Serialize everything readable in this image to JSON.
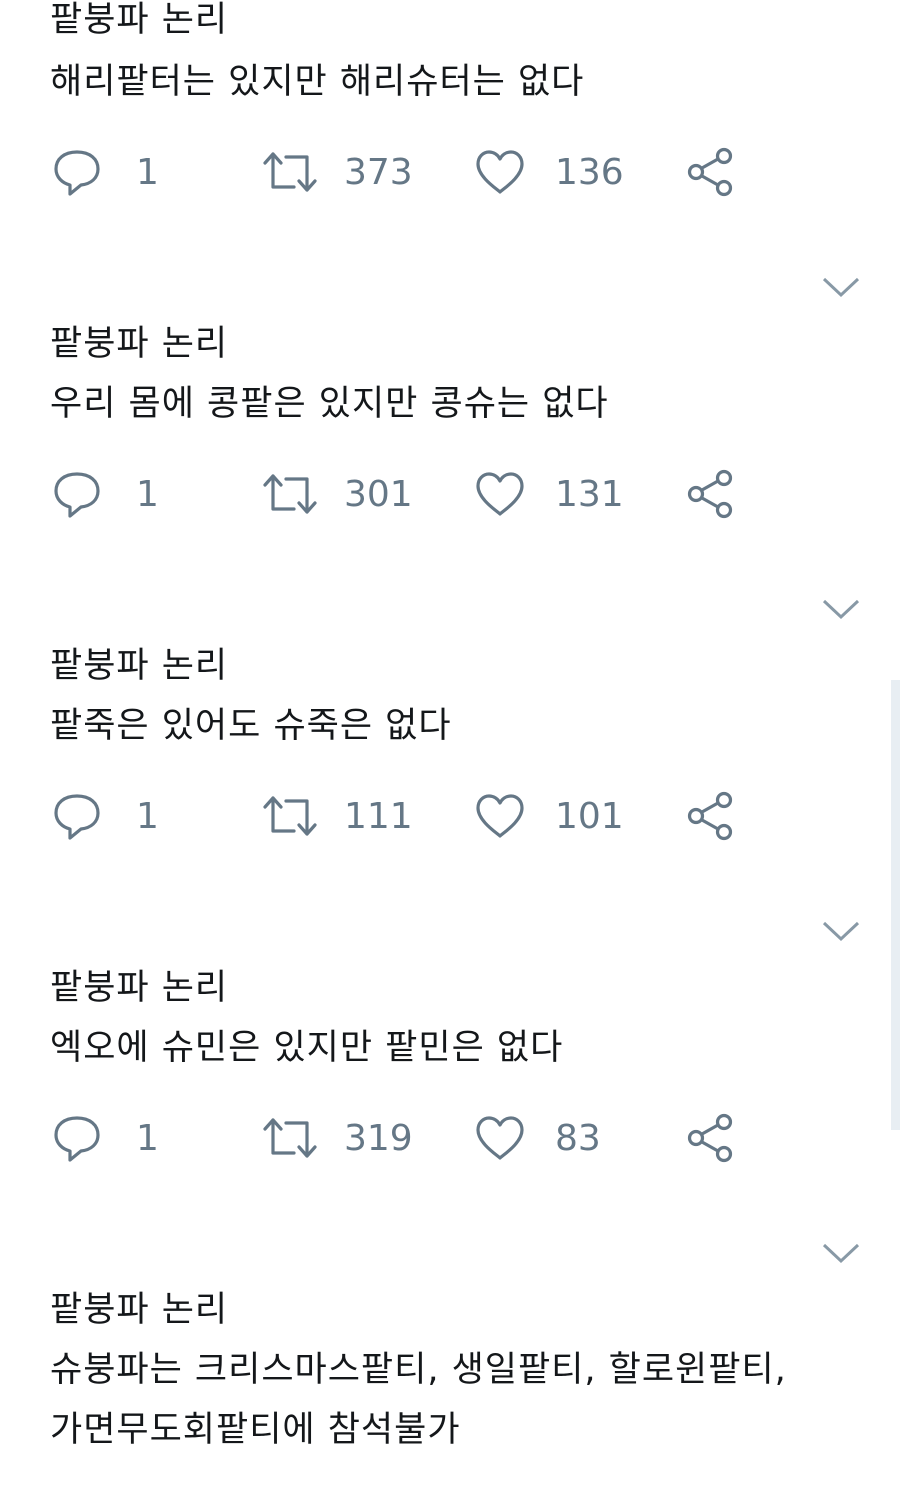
{
  "tweets": [
    {
      "lines": [
        "팥붕파 논리",
        "해리팥터는 있지만 해리슈터는 없다"
      ],
      "actions": {
        "reply": "1",
        "retweet": "373",
        "like": "136"
      }
    },
    {
      "lines": [
        "팥붕파 논리",
        "우리 몸에 콩팥은 있지만 콩슈는 없다"
      ],
      "actions": {
        "reply": "1",
        "retweet": "301",
        "like": "131"
      }
    },
    {
      "lines": [
        "팥붕파 논리",
        "팥죽은 있어도 슈죽은 없다"
      ],
      "actions": {
        "reply": "1",
        "retweet": "111",
        "like": "101"
      }
    },
    {
      "lines": [
        "팥붕파 논리",
        "엑오에 슈민은 있지만 팥민은 없다"
      ],
      "actions": {
        "reply": "1",
        "retweet": "319",
        "like": "83"
      }
    },
    {
      "lines": [
        "팥붕파 논리",
        "슈붕파는 크리스마스팥티, 생일팥티, 할로윈팥티,",
        "가면무도회팥티에 참석불가"
      ]
    }
  ],
  "icons": {
    "reply": "reply-icon",
    "retweet": "retweet-icon",
    "like": "like-icon",
    "share": "share-icon",
    "caret": "chevron-down-icon"
  },
  "colors": {
    "text": "#14171a",
    "icon": "#657786",
    "scrollbar": "#e8eef3"
  }
}
